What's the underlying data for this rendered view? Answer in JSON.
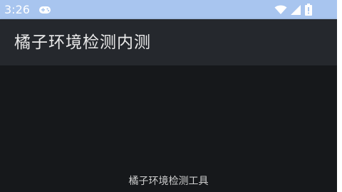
{
  "status_bar": {
    "time": "3:26",
    "background_color": "#a8c5ef",
    "icons": [
      "gamepad-icon",
      "wifi-icon",
      "signal-icon",
      "battery-icon"
    ]
  },
  "app_bar": {
    "title": "橘子环境检测内测",
    "background_color": "#25282d"
  },
  "content": {
    "background_color": "#16181b",
    "footer_text": "橘子环境检测工具"
  }
}
